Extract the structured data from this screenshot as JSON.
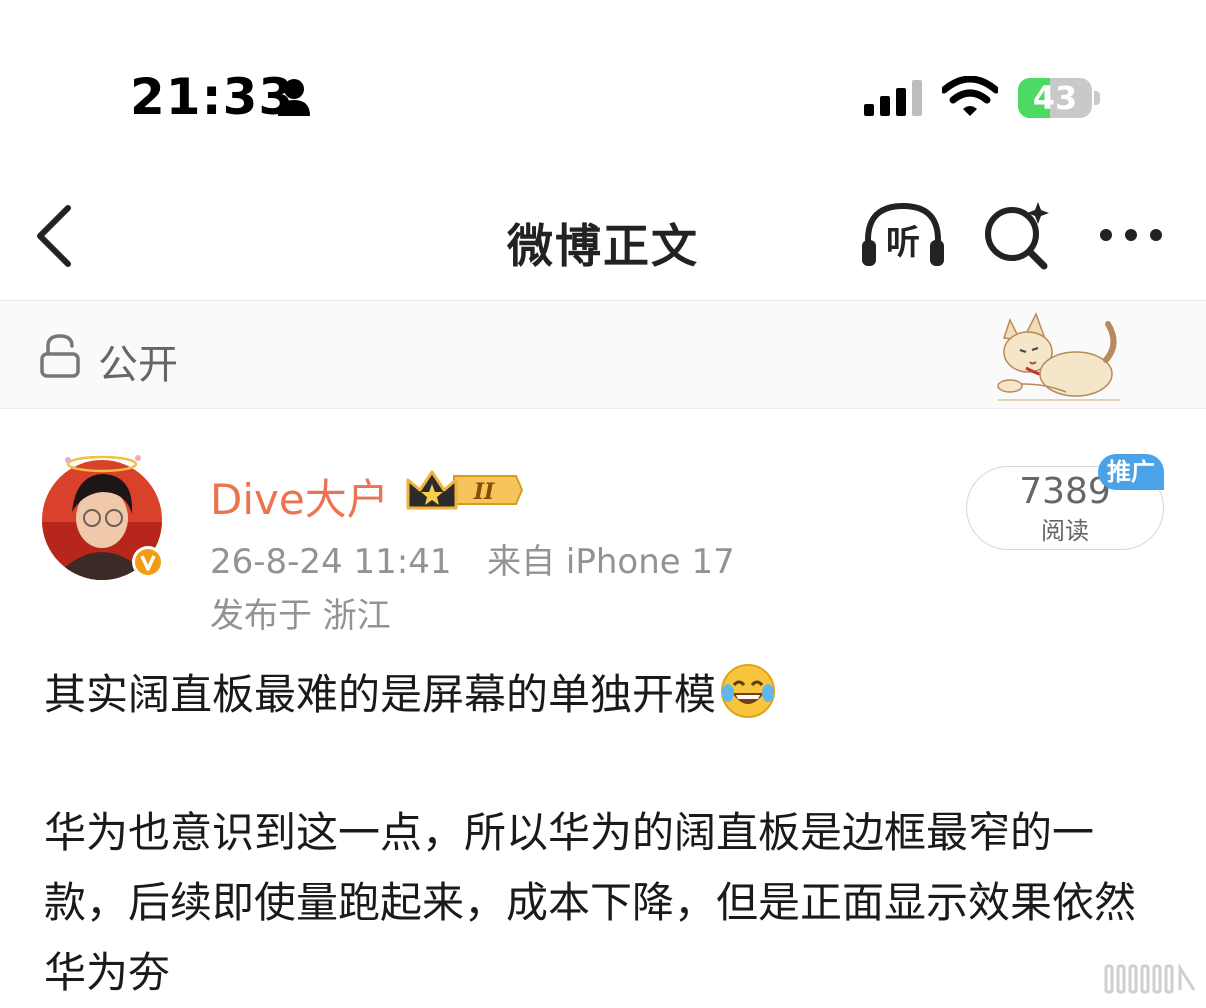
{
  "status_bar": {
    "time": "21:33",
    "battery": "43",
    "battery_level": 0.43
  },
  "navbar": {
    "title": "微博正文",
    "listen_label": "听"
  },
  "visibility": {
    "label": "公开"
  },
  "post": {
    "author": "Dive大户",
    "member_level": "II",
    "date": "26-8-24 11:41",
    "source": "来自 iPhone 17",
    "location": "发布于 浙江",
    "read_count": "7389",
    "read_label": "阅读",
    "promo_badge": "推广",
    "paragraphs": [
      "其实阔直板最难的是屏幕的单独开模",
      "华为也意识到这一点，所以华为的阔直板是边框最窄的一款，后续即使量跑起来，成本下降，但是正面显示效果依然华为夯"
    ]
  },
  "icons": [
    "person-icon",
    "signal-icon",
    "wifi-icon",
    "back-icon",
    "listen-icon",
    "search-icon",
    "more-icon",
    "lock-icon",
    "dog-sticker-icon",
    "verified-icon",
    "crown-icon",
    "laugh-cry-icon"
  ],
  "colors": {
    "author": "#eb7350",
    "battery_fill": "#4cd964",
    "promo": "#4aa3e8",
    "verified": "#f39c12"
  }
}
